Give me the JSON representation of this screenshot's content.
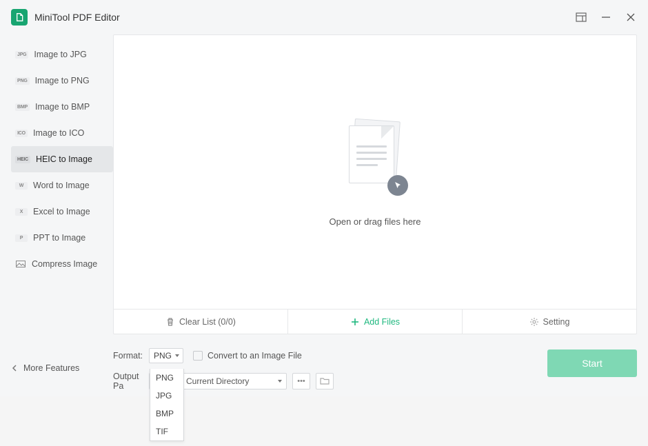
{
  "app_title": "MiniTool PDF Editor",
  "sidebar": {
    "items": [
      {
        "badge": "JPG",
        "label": "Image to JPG"
      },
      {
        "badge": "PNG",
        "label": "Image to PNG"
      },
      {
        "badge": "BMP",
        "label": "Image to BMP"
      },
      {
        "badge": "ICO",
        "label": "Image to ICO"
      },
      {
        "badge": "HEIC",
        "label": "HEIC to Image"
      },
      {
        "badge": "W",
        "label": "Word to Image"
      },
      {
        "badge": "X",
        "label": "Excel to Image"
      },
      {
        "badge": "P",
        "label": "PPT to Image"
      },
      {
        "badge": "",
        "label": "Compress Image"
      }
    ]
  },
  "dropzone": {
    "text": "Open or drag files here"
  },
  "actions": {
    "clear": "Clear List (0/0)",
    "add": "Add Files",
    "setting": "Setting"
  },
  "form": {
    "format_label": "Format:",
    "format_value": "PNG",
    "convert_checkbox": "Convert to an Image File",
    "output_label": "Output Pa",
    "output_value": "ument's Current Directory"
  },
  "format_options": [
    "PNG",
    "JPG",
    "BMP",
    "TIF"
  ],
  "more_features": "More Features",
  "start": "Start"
}
